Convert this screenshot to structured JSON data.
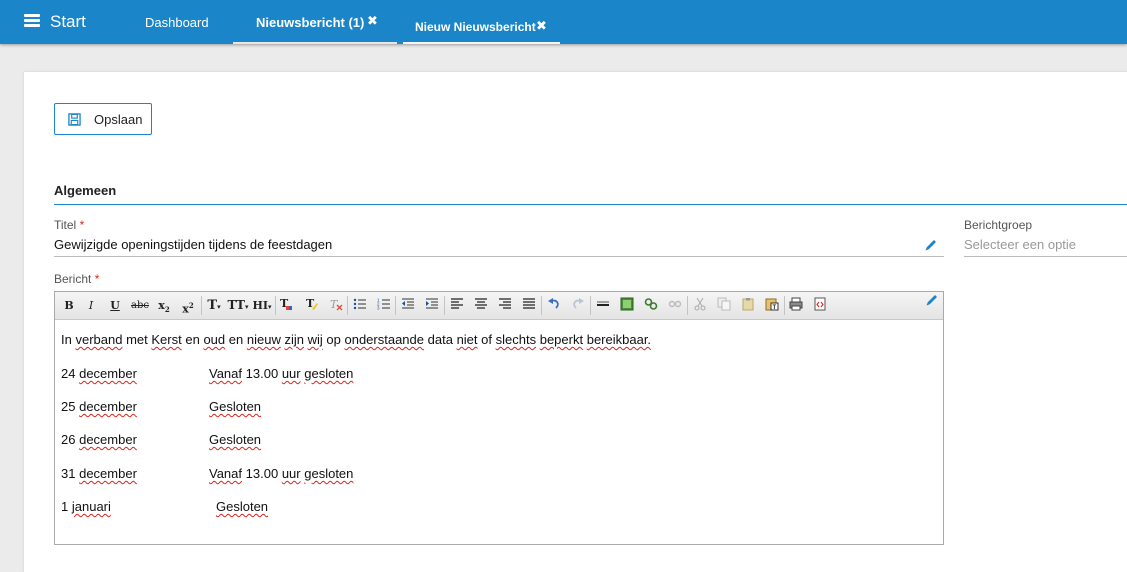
{
  "app": {
    "title": "Start"
  },
  "tabs": [
    {
      "label": "Dashboard"
    },
    {
      "label": "Nieuwsbericht (1)"
    },
    {
      "label": "Nieuw Nieuwsbericht"
    }
  ],
  "toolbar": {
    "save_label": "Opslaan"
  },
  "section": {
    "title": "Algemeen"
  },
  "fields": {
    "titel_label": "Titel",
    "titel_value": "Gewijzigde openingstijden tijdens de feestdagen",
    "required_mark": "*",
    "berichtgroep_label": "Berichtgroep",
    "berichtgroep_placeholder": "Selecteer een optie",
    "bericht_label": "Bericht"
  },
  "editor": {
    "buttons": {
      "bold": "B",
      "italic": "I",
      "underline": "U",
      "strike": "abc",
      "subscript": "x",
      "superscript": "x",
      "font_size": "T",
      "font_family": "TT",
      "heading": "HI"
    },
    "intro": {
      "w1": "In",
      "w2": "verband",
      "w3": "met",
      "w4": "Kerst",
      "w5": "en",
      "w6": "oud",
      "w7": "en",
      "w8": "nieuw",
      "w9": "zijn",
      "w10": "wij",
      "w11": "op",
      "w12": "onderstaande",
      "w13": "data",
      "w14": "niet",
      "w15": "of",
      "w16": "slechts",
      "w17": "beperkt",
      "w18": "bereikbaar."
    },
    "rows": [
      {
        "day": "24",
        "month": "december",
        "status_a": "Vanaf",
        "status_b": "13.00",
        "status_c": "uur",
        "status_d": "gesloten"
      },
      {
        "day": "25",
        "month": "december",
        "status": "Gesloten"
      },
      {
        "day": "26",
        "month": "december",
        "status": "Gesloten"
      },
      {
        "day": "31",
        "month": "december",
        "status_a": "Vanaf",
        "status_b": "13.00",
        "status_c": "uur",
        "status_d": "gesloten"
      },
      {
        "day": "1",
        "month": "januari",
        "status": "Gesloten"
      }
    ]
  },
  "colors": {
    "accent": "#1a85c8",
    "required": "#d9251d",
    "spell_underline": "#d9251d"
  },
  "icons": [
    "menu-icon",
    "close-icon",
    "save-icon",
    "pencil-icon"
  ]
}
